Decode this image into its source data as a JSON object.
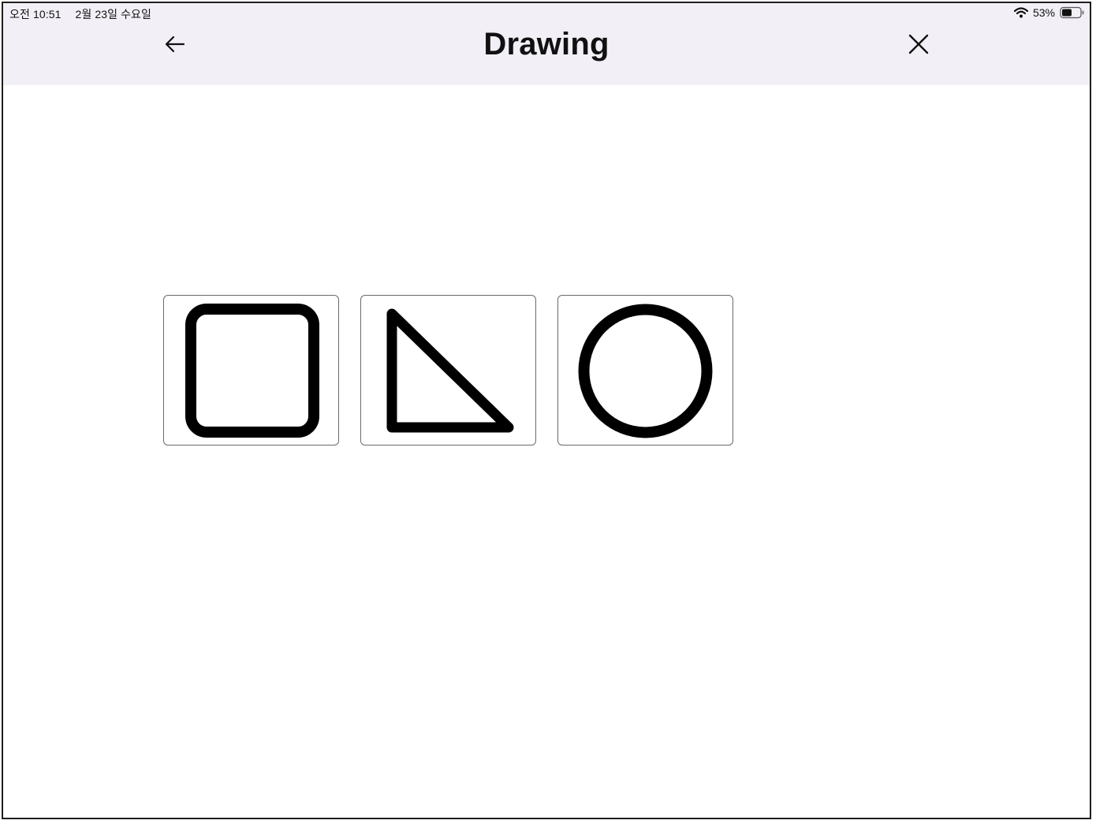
{
  "status_bar": {
    "time": "오전 10:51",
    "date": "2월 23일 수요일",
    "battery": "53%",
    "wifi_icon": "wifi-icon",
    "battery_icon": "battery-icon"
  },
  "header": {
    "title": "Drawing",
    "back_icon": "arrow-left-icon",
    "close_icon": "close-icon",
    "background": "#f2f0f6"
  },
  "shapes": [
    {
      "name": "square",
      "icon": "square-icon"
    },
    {
      "name": "triangle",
      "icon": "triangle-icon"
    },
    {
      "name": "circle",
      "icon": "circle-icon"
    }
  ]
}
